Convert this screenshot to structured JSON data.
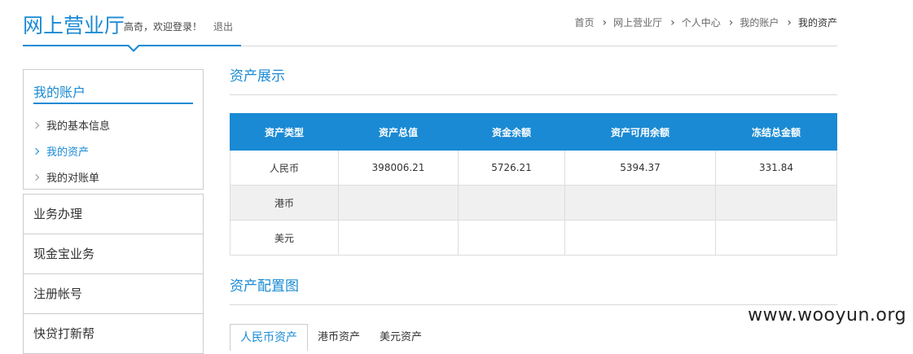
{
  "header": {
    "logo": "网上营业厅",
    "greeting": "高奇，欢迎登录！",
    "logout": "退出"
  },
  "breadcrumb": [
    "首页",
    "网上营业厅",
    "个人中心",
    "我的账户",
    "我的资产"
  ],
  "sidebar": {
    "account_title": "我的账户",
    "sub_items": [
      {
        "label": "我的基本信息",
        "active": false
      },
      {
        "label": "我的资产",
        "active": true
      },
      {
        "label": "我的对账单",
        "active": false
      }
    ],
    "menu": [
      "业务办理",
      "现金宝业务",
      "注册帐号",
      "快贷打新帮"
    ]
  },
  "assets": {
    "title": "资产展示",
    "columns": [
      "资产类型",
      "资产总值",
      "资金余额",
      "资产可用余额",
      "冻结总金额"
    ],
    "rows": [
      [
        "人民币",
        "398006.21",
        "5726.21",
        "5394.37",
        "331.84"
      ],
      [
        "港币",
        "",
        "",
        "",
        ""
      ],
      [
        "美元",
        "",
        "",
        "",
        ""
      ]
    ]
  },
  "allocation": {
    "title": "资产配置图",
    "tabs": [
      "人民币资产",
      "港币资产",
      "美元资产"
    ]
  },
  "watermark": "www.wooyun.org",
  "colors": {
    "accent": "#1a8ad4"
  }
}
